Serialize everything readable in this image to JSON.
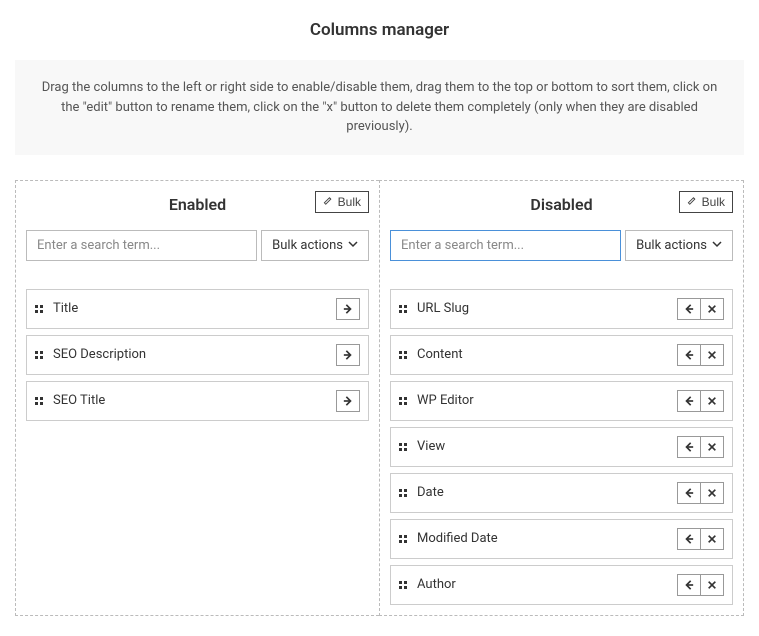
{
  "title": "Columns manager",
  "instructions": "Drag the columns to the left or right side to enable/disable them, drag them to the top or bottom to sort them, click on the \"edit\" button to rename them, click on the \"x\" button to delete them completely (only when they are disabled previously).",
  "bulk_label": "Bulk",
  "bulk_actions_label": "Bulk actions",
  "search_placeholder": "Enter a search term...",
  "enabled": {
    "heading": "Enabled",
    "items": [
      {
        "label": "Title"
      },
      {
        "label": "SEO Description"
      },
      {
        "label": "SEO Title"
      }
    ]
  },
  "disabled": {
    "heading": "Disabled",
    "items": [
      {
        "label": "URL Slug"
      },
      {
        "label": "Content"
      },
      {
        "label": "WP Editor"
      },
      {
        "label": "View"
      },
      {
        "label": "Date"
      },
      {
        "label": "Modified Date"
      },
      {
        "label": "Author"
      }
    ]
  }
}
